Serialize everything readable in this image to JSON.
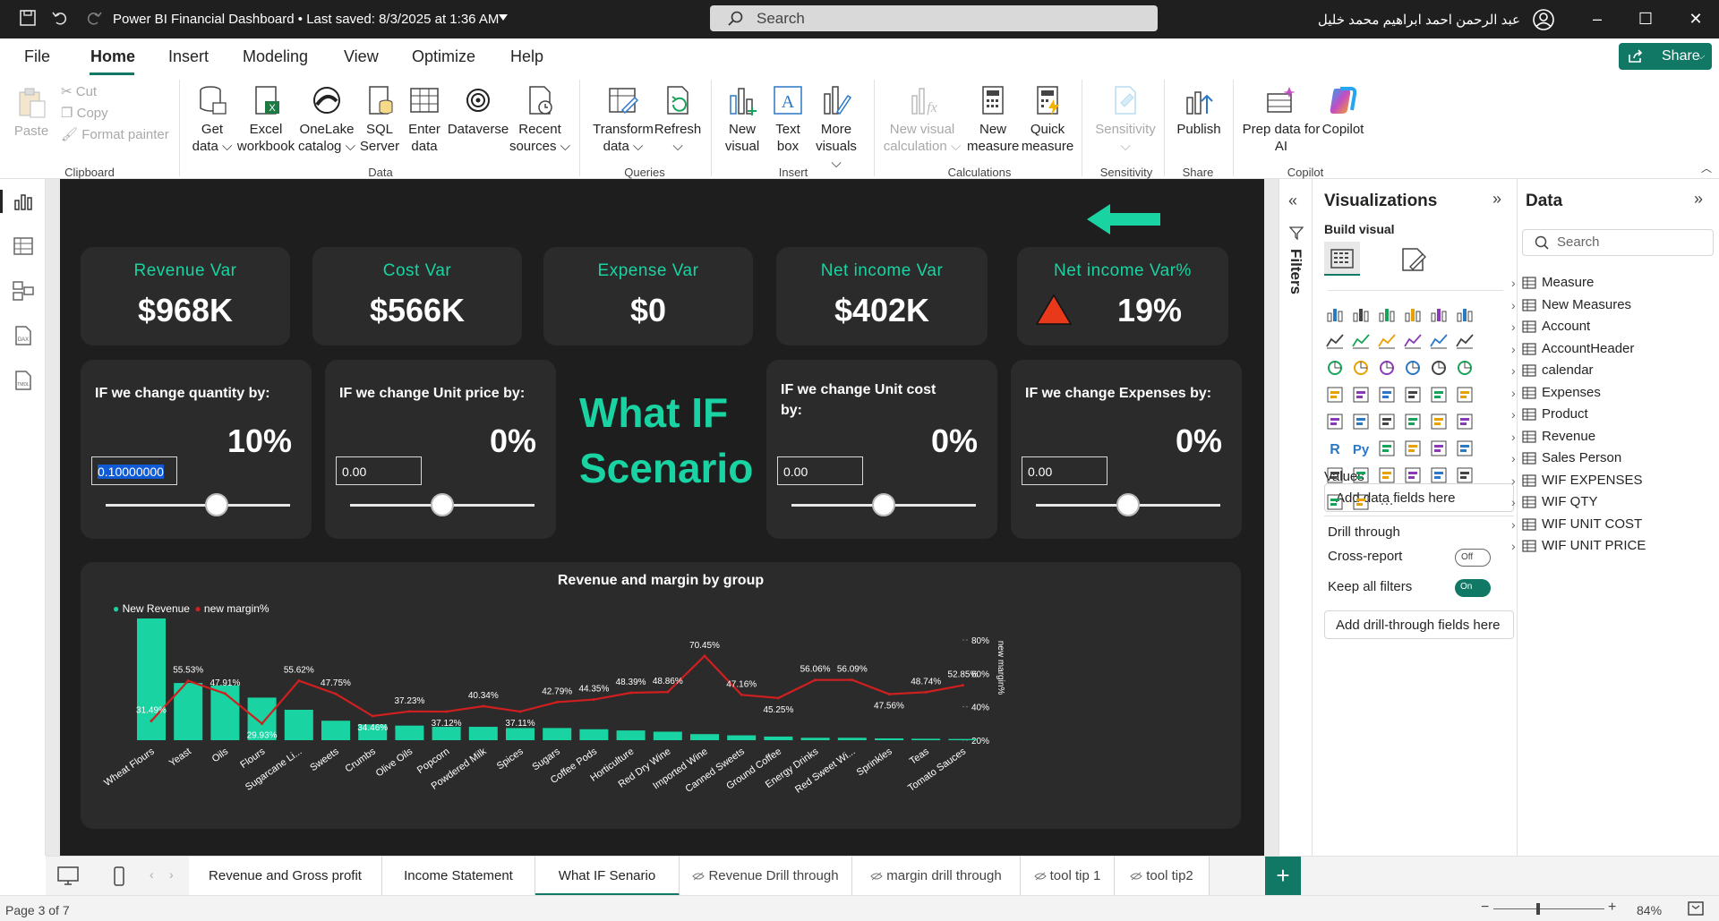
{
  "titlebar": {
    "doc_title": "Power BI Financial Dashboard • Last saved: 8/3/2025 at 1:36 AM",
    "search_placeholder": "Search",
    "user": "عبد الرحمن احمد ابراهيم محمد خليل"
  },
  "menu": {
    "file": "File",
    "home": "Home",
    "insert": "Insert",
    "modeling": "Modeling",
    "view": "View",
    "optimize": "Optimize",
    "help": "Help",
    "share": "Share"
  },
  "ribbon": {
    "paste": "Paste",
    "cut": "Cut",
    "copy": "Copy",
    "format_painter": "Format painter",
    "get_data": [
      "Get",
      "data"
    ],
    "excel": [
      "Excel",
      "workbook"
    ],
    "onelake": [
      "OneLake",
      "catalog"
    ],
    "sql": [
      "SQL",
      "Server"
    ],
    "enter_data": [
      "Enter",
      "data"
    ],
    "dataverse": [
      "Dataverse",
      ""
    ],
    "recent": [
      "Recent",
      "sources"
    ],
    "transform": [
      "Transform",
      "data"
    ],
    "refresh": [
      "Refresh",
      ""
    ],
    "new_visual": [
      "New",
      "visual"
    ],
    "text_box": [
      "Text",
      "box"
    ],
    "more_visuals": [
      "More",
      "visuals"
    ],
    "new_visual_calc": [
      "New visual",
      "calculation"
    ],
    "new_measure": [
      "New",
      "measure"
    ],
    "quick_measure": [
      "Quick",
      "measure"
    ],
    "sensitivity": [
      "Sensitivity",
      ""
    ],
    "publish": [
      "Publish",
      ""
    ],
    "prep_copilot": [
      "Prep data for",
      "AI"
    ],
    "copilot": [
      "Copilot",
      ""
    ],
    "groups": {
      "clipboard": "Clipboard",
      "data": "Data",
      "queries": "Queries",
      "insert": "Insert",
      "calculations": "Calculations",
      "sensitivity": "Sensitivity",
      "share": "Share",
      "copilot": "Copilot"
    }
  },
  "kpis": [
    {
      "title": "Revenue Var",
      "value": "$968K"
    },
    {
      "title": "Cost Var",
      "value": "$566K"
    },
    {
      "title": "Expense Var",
      "value": "$0"
    },
    {
      "title": "Net income Var",
      "value": "$402K"
    },
    {
      "title": "Net income Var%",
      "value": "19%"
    }
  ],
  "whatif": [
    {
      "title": "IF we change quantity by:",
      "pct": "10%",
      "input": "0.10000000",
      "level": 0.6
    },
    {
      "title": "IF we change Unit price by:",
      "pct": "0%",
      "input": "0.00",
      "level": 0.5
    },
    {
      "title": "IF we change Unit cost by:",
      "pct": "0%",
      "input": "0.00",
      "level": 0.5
    },
    {
      "title": "IF we change Expenses by:",
      "pct": "0%",
      "input": "0.00",
      "level": 0.5
    }
  ],
  "scenario_title": [
    "What IF",
    "Scenario"
  ],
  "chart_data": {
    "type": "bar",
    "title": "Revenue and margin by group",
    "categories": [
      "Wheat Flours",
      "Yeast",
      "Oils",
      "Flours",
      "Sugarcane Li...",
      "Sweets",
      "Crumbs",
      "Olive Oils",
      "Popcorn",
      "Powdered Milk",
      "Spices",
      "Sugars",
      "Coffee Pods",
      "Horticulture",
      "Red Dry Wine",
      "Imported Wine",
      "Canned Sweets",
      "Ground Coffee",
      "Energy Drinks",
      "Red Sweet Wi...",
      "Sprinkles",
      "Teas",
      "Tomato Sauces"
    ],
    "series": [
      {
        "name": "New Revenue",
        "type": "bar",
        "color": "#19d3a2",
        "values": [
          100,
          47,
          45,
          35,
          25,
          16,
          13,
          12,
          11,
          11,
          10,
          10,
          9,
          8,
          7,
          5,
          4,
          3,
          2,
          2,
          1.5,
          1.2,
          1
        ]
      },
      {
        "name": "new margin%",
        "type": "line",
        "color": "#d01f1f",
        "axis": "right",
        "values": [
          31.49,
          55.53,
          47.91,
          29.93,
          55.62,
          47.75,
          34.46,
          37.23,
          37.12,
          40.34,
          37.11,
          42.79,
          44.35,
          48.39,
          48.86,
          70.45,
          47.16,
          45.25,
          56.06,
          56.09,
          47.56,
          48.74,
          52.85
        ]
      }
    ],
    "labels": [
      "31.49%",
      "55.53%",
      "47.91%",
      "29.93%",
      "55.62%",
      "47.75%",
      "34.46%",
      "37.23%",
      "37.12%",
      "40.34%",
      "37.11%",
      "42.79%",
      "44.35%",
      "48.39%",
      "48.86%",
      "70.45%",
      "47.16%",
      "45.25%",
      "56.06%",
      "56.09%",
      "47.56%",
      "48.74%",
      "52.85%"
    ],
    "y2_ticks": [
      "80%",
      "60%",
      "40%",
      "20%"
    ],
    "y2label": "new margin%",
    "legend": "top-left"
  },
  "filters_label": "Filters",
  "visualizations": {
    "title": "Visualizations",
    "build": "Build visual",
    "values": "Values",
    "add_data": "Add data fields here",
    "drill": "Drill through",
    "cross": "Cross-report",
    "cross_state": "Off",
    "keep": "Keep all filters",
    "keep_state": "On",
    "add_drill": "Add drill-through fields here"
  },
  "data_pane": {
    "title": "Data",
    "search": "Search",
    "items": [
      "Measure",
      "New Measures",
      "Account",
      "AccountHeader",
      "calendar",
      "Expenses",
      "Product",
      "Revenue",
      "Sales Person",
      "WIF EXPENSES",
      "WIF QTY",
      "WIF UNIT COST",
      "WIF UNIT PRICE"
    ]
  },
  "tabs": [
    "Revenue and Gross profit",
    "Income Statement",
    "What IF Senario",
    "Revenue Drill through",
    "margin drill through",
    "tool tip 1",
    "tool tip2"
  ],
  "status": {
    "page": "Page 3 of 7",
    "zoom": "84%"
  }
}
